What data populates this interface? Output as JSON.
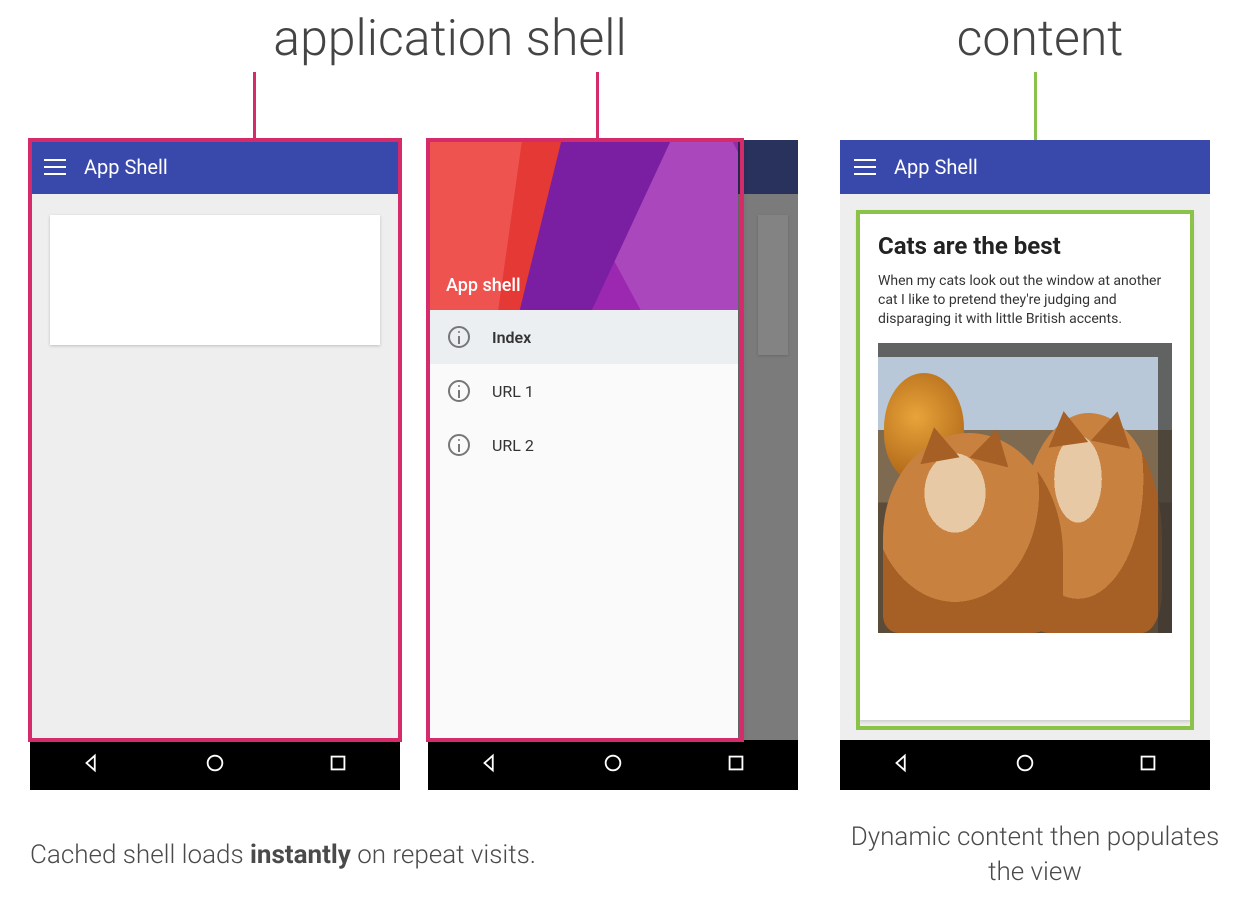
{
  "labels": {
    "application_shell": "application shell",
    "content": "content"
  },
  "colors": {
    "highlight_pink": "#d52b6a",
    "highlight_green": "#8bc34a",
    "appbar_blue": "#3949ab"
  },
  "phone1": {
    "appbar_title": "App Shell"
  },
  "phone2": {
    "drawer_title": "App shell",
    "items": [
      {
        "label": "Index",
        "active": true
      },
      {
        "label": "URL 1",
        "active": false
      },
      {
        "label": "URL 2",
        "active": false
      }
    ]
  },
  "phone3": {
    "appbar_title": "App Shell",
    "content_title": "Cats are the best",
    "content_body": "When my cats look out the window at another cat I like to pretend they're judging and disparaging it with little British accents."
  },
  "captions": {
    "left_pre": "Cached shell loads ",
    "left_bold": "instantly",
    "left_post": " on repeat visits.",
    "right": "Dynamic content then populates the view"
  }
}
